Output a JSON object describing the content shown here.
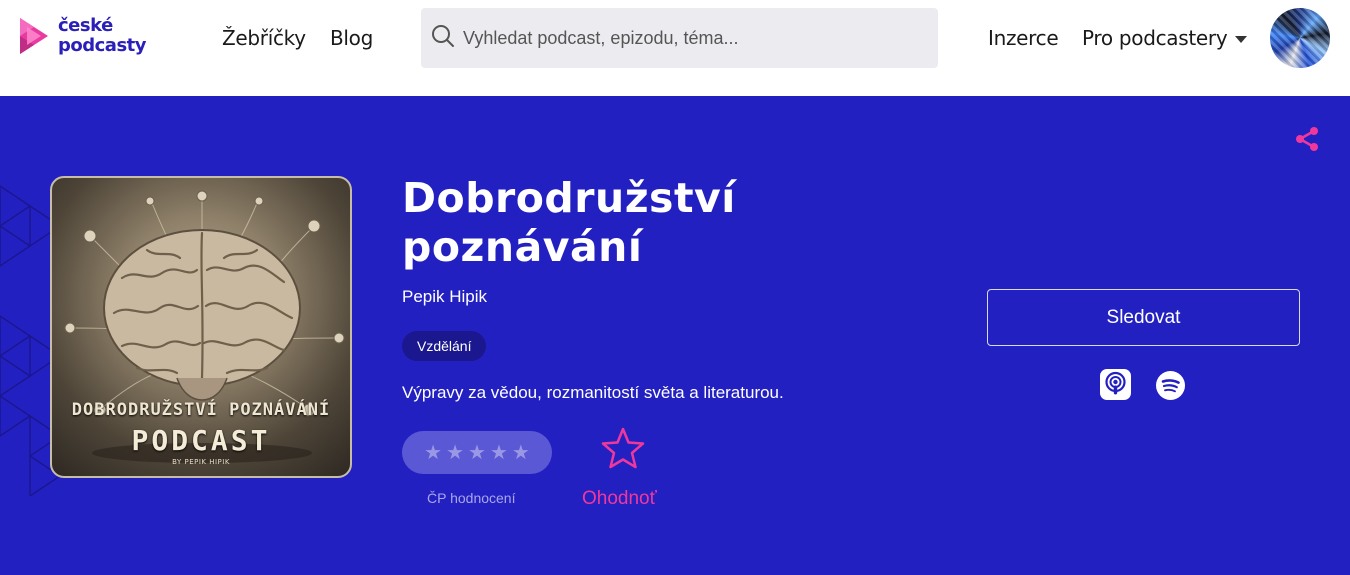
{
  "header": {
    "logo": {
      "line1": "české",
      "line2": "podcasty",
      "icon": "play-triangles-logo",
      "brand_color": "#2a1fb8",
      "accent": "#e83aa0"
    },
    "nav": {
      "charts": "Žebříčky",
      "blog": "Blog",
      "ads": "Inzerce",
      "for_podcasters": "Pro podcastery"
    },
    "search": {
      "placeholder": "Vyhledat podcast, epizodu, téma...",
      "value": "",
      "icon": "search-icon"
    },
    "avatar_icon": "user-avatar"
  },
  "podcast": {
    "title": "Dobrodružství poznávání",
    "author": "Pepik Hipik",
    "category": "Vzdělání",
    "description": "Výpravy za vědou, rozmanitostí světa a literaturou.",
    "cover": {
      "line1": "DOBRODRUŽSTVÍ POZNÁVÁNÍ",
      "line2": "PODCAST",
      "line3": "BY PEPIK HIPIK"
    },
    "rating": {
      "stars_filled": 0,
      "stars_total": 5,
      "label": "ČP hodnocení"
    },
    "rate_action": "Ohodnoť",
    "follow_label": "Sledovat",
    "platforms": [
      "apple-podcasts-icon",
      "spotify-icon"
    ]
  },
  "colors": {
    "hero_bg": "#2320c2",
    "accent_pink": "#f0389c",
    "tag_bg": "#1b188f"
  }
}
